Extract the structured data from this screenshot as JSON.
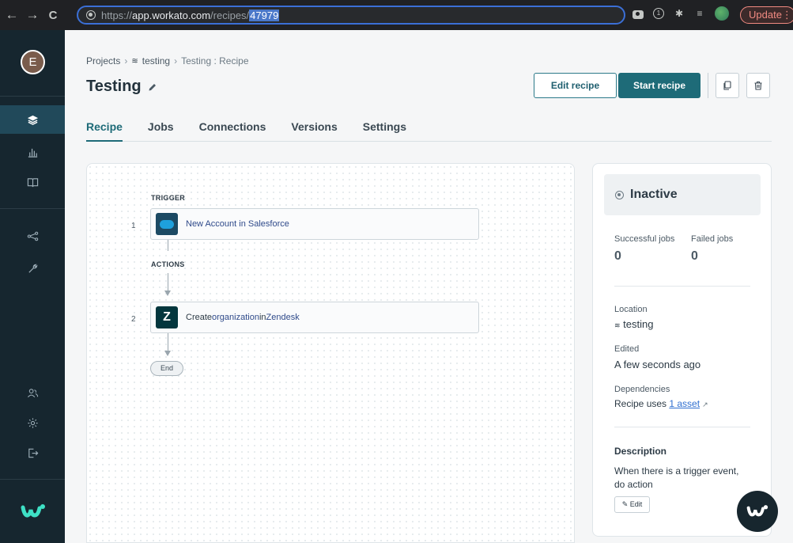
{
  "browser": {
    "url_prefix": "https://",
    "url_domain": "app.workato.com",
    "url_path": "/recipes/",
    "url_selected": "47979",
    "update_label": "Update"
  },
  "sidebar": {
    "avatar_initial": "E"
  },
  "breadcrumb": {
    "projects": "Projects",
    "folder": "testing",
    "current": "Testing : Recipe"
  },
  "page": {
    "title": "Testing",
    "edit_recipe": "Edit recipe",
    "start_recipe": "Start recipe"
  },
  "tabs": [
    {
      "label": "Recipe"
    },
    {
      "label": "Jobs"
    },
    {
      "label": "Connections"
    },
    {
      "label": "Versions"
    },
    {
      "label": "Settings"
    }
  ],
  "recipe": {
    "trigger_label": "TRIGGER",
    "actions_label": "ACTIONS",
    "steps": [
      {
        "num": "1",
        "text": "New Account in Salesforce"
      },
      {
        "num": "2",
        "text_prefix": "Create ",
        "text_obj": "organization",
        "text_mid": " in ",
        "text_app": "Zendesk"
      }
    ],
    "end_label": "End"
  },
  "panel": {
    "status": "Inactive",
    "successful_jobs_label": "Successful jobs",
    "failed_jobs_label": "Failed jobs",
    "successful_jobs": "0",
    "failed_jobs": "0",
    "location_label": "Location",
    "location_value": "testing",
    "edited_label": "Edited",
    "edited_value": "A few seconds ago",
    "dependencies_label": "Dependencies",
    "dependencies_prefix": "Recipe uses ",
    "dependencies_link": "1 asset",
    "description_heading": "Description",
    "description_line1": "When there is a trigger event,",
    "description_line2": "do action",
    "edit_label": "Edit"
  },
  "colors": {
    "sidebar_bg": "#16262f",
    "accent": "#1e6b78",
    "link": "#2f6fd0"
  }
}
